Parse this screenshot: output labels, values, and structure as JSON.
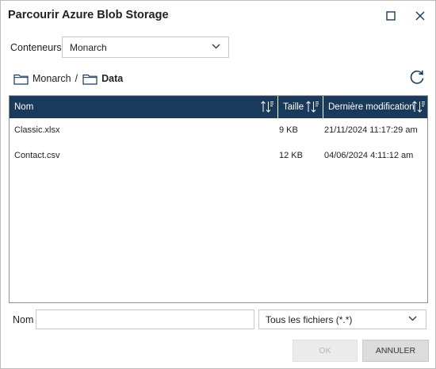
{
  "dialog": {
    "title": "Parcourir Azure Blob Storage",
    "maximize_icon": "maximize-icon",
    "close_icon": "close-icon"
  },
  "container": {
    "label": "Conteneurs",
    "selected": "Monarch"
  },
  "breadcrumb": {
    "items": [
      {
        "label": "Monarch",
        "icon": "folder-icon"
      },
      {
        "label": "Data",
        "icon": "folder-icon"
      }
    ],
    "separator": "/",
    "refresh_icon": "refresh-icon"
  },
  "grid": {
    "header_color": "#1a3a5c",
    "columns": [
      {
        "label": "Nom",
        "sort_icon": "sort-icon"
      },
      {
        "label": "Taille",
        "sort_icon": "sort-icon"
      },
      {
        "label": "Dernière modification",
        "sort_icon": "sort-icon"
      }
    ],
    "rows": [
      {
        "name": "Classic.xlsx",
        "size": "9 KB",
        "modified": "21/11/2024 11:17:29 am"
      },
      {
        "name": "Contact.csv",
        "size": "12 KB",
        "modified": "04/06/2024 4:11:12 am"
      }
    ]
  },
  "footer": {
    "name_label": "Nom",
    "name_value": "",
    "filter_selected": "Tous les fichiers (*.*)",
    "ok_label": "OK",
    "cancel_label": "ANNULER"
  }
}
